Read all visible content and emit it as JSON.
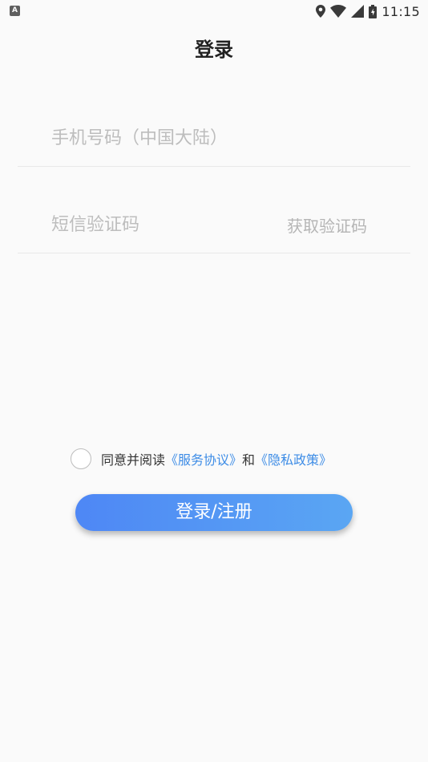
{
  "status_bar": {
    "left_icon": "A",
    "time": "11:15",
    "icons": [
      "location-icon",
      "wifi-icon",
      "signal-icon",
      "battery-icon"
    ]
  },
  "header": {
    "title": "登录"
  },
  "form": {
    "phone": {
      "value": "",
      "placeholder": "手机号码（中国大陆）"
    },
    "code": {
      "value": "",
      "placeholder": "短信验证码",
      "get_code_label": "获取验证码"
    }
  },
  "agreement": {
    "checked": false,
    "prefix": "同意并阅读",
    "service_link": "《服务协议》",
    "conjunction": "和",
    "privacy_link": "《隐私政策》"
  },
  "login_button": {
    "label": "登录/注册"
  },
  "colors": {
    "background": "#fafafa",
    "link": "#3d8ce6",
    "button_start": "#4e87f5",
    "button_end": "#5aa6f3",
    "placeholder": "#bdbdbd"
  }
}
